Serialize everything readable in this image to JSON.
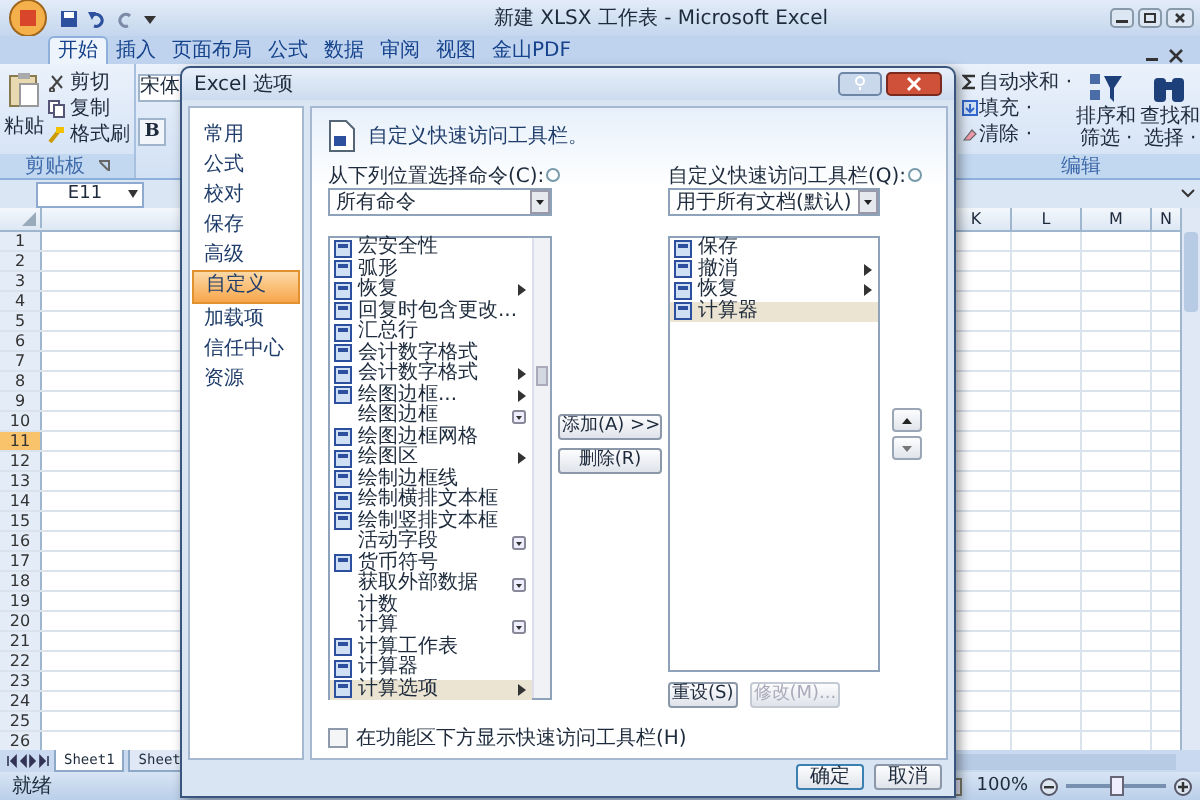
{
  "window": {
    "title": "新建 XLSX 工作表 - Microsoft Excel"
  },
  "ribbon_tabs": [
    {
      "label": "开始",
      "selected": true
    },
    {
      "label": "插入",
      "selected": false
    },
    {
      "label": "页面布局",
      "selected": false
    },
    {
      "label": "公式",
      "selected": false
    },
    {
      "label": "数据",
      "selected": false
    },
    {
      "label": "审阅",
      "selected": false
    },
    {
      "label": "视图",
      "selected": false
    },
    {
      "label": "金山PDF",
      "selected": false
    }
  ],
  "clipboard_group": {
    "paste": "粘贴",
    "commands": [
      "剪切",
      "复制",
      "格式刷"
    ],
    "label": "剪贴板"
  },
  "font_group": {
    "font": "宋体",
    "bold_button": "B"
  },
  "editing_group": {
    "commands": [
      "自动求和 ·",
      "填充 ·",
      "清除 ·"
    ],
    "large_commands": [
      {
        "lines": [
          "排序和",
          "筛选 ·"
        ]
      },
      {
        "lines": [
          "查找和",
          "选择 ·"
        ]
      }
    ],
    "label": "编辑"
  },
  "name_box": "E11",
  "sheet": {
    "columns": [
      "K",
      "L",
      "M",
      "N"
    ],
    "rows": [
      {
        "label": "1",
        "selected": false
      },
      {
        "label": "2",
        "selected": false
      },
      {
        "label": "3",
        "selected": false
      },
      {
        "label": "4",
        "selected": false
      },
      {
        "label": "5",
        "selected": false
      },
      {
        "label": "6",
        "selected": false
      },
      {
        "label": "7",
        "selected": false
      },
      {
        "label": "8",
        "selected": false
      },
      {
        "label": "9",
        "selected": false
      },
      {
        "label": "10",
        "selected": false
      },
      {
        "label": "11",
        "selected": true
      },
      {
        "label": "12",
        "selected": false
      },
      {
        "label": "13",
        "selected": false
      },
      {
        "label": "14",
        "selected": false
      },
      {
        "label": "15",
        "selected": false
      },
      {
        "label": "16",
        "selected": false
      },
      {
        "label": "17",
        "selected": false
      },
      {
        "label": "18",
        "selected": false
      },
      {
        "label": "19",
        "selected": false
      },
      {
        "label": "20",
        "selected": false
      },
      {
        "label": "21",
        "selected": false
      },
      {
        "label": "22",
        "selected": false
      },
      {
        "label": "23",
        "selected": false
      },
      {
        "label": "24",
        "selected": false
      },
      {
        "label": "25",
        "selected": false
      },
      {
        "label": "26",
        "selected": false
      }
    ]
  },
  "sheet_tabs": [
    {
      "label": "Sheet1",
      "selected": true
    },
    {
      "label": "Sheet",
      "selected": false
    }
  ],
  "status_bar": {
    "status": "就绪",
    "zoom": "100%",
    "zoom_slider": {
      "level": 0.5
    }
  },
  "dialog": {
    "title": "Excel 选项",
    "nav": [
      {
        "label": "常用",
        "selected": false
      },
      {
        "label": "公式",
        "selected": false
      },
      {
        "label": "校对",
        "selected": false
      },
      {
        "label": "保存",
        "selected": false
      },
      {
        "label": "高级",
        "selected": false
      },
      {
        "label": "自定义",
        "selected": true
      },
      {
        "label": "加载项",
        "selected": false
      },
      {
        "label": "信任中心",
        "selected": false
      },
      {
        "label": "资源",
        "selected": false
      }
    ],
    "header": "自定义快速访问工具栏。",
    "from_label": "从下列位置选择命令(C):",
    "from_value": "所有命令",
    "to_label": "自定义快速访问工具栏(Q):",
    "to_value": "用于所有文档(默认)",
    "commands": [
      {
        "label": "宏安全性",
        "icon": true,
        "kind": "plain",
        "selected": false
      },
      {
        "label": "弧形",
        "icon": true,
        "kind": "plain",
        "selected": false
      },
      {
        "label": "恢复",
        "icon": true,
        "kind": "submenu",
        "selected": false
      },
      {
        "label": "回复时包含更改...",
        "icon": true,
        "kind": "plain",
        "selected": false
      },
      {
        "label": "汇总行",
        "icon": true,
        "kind": "plain",
        "selected": false
      },
      {
        "label": "会计数字格式",
        "icon": true,
        "kind": "plain",
        "selected": false
      },
      {
        "label": "会计数字格式",
        "icon": true,
        "kind": "submenu",
        "selected": false
      },
      {
        "label": "绘图边框...",
        "icon": true,
        "kind": "submenu",
        "selected": false
      },
      {
        "label": "绘图边框",
        "icon": false,
        "kind": "dropdown",
        "selected": false
      },
      {
        "label": "绘图边框网格",
        "icon": true,
        "kind": "plain",
        "selected": false
      },
      {
        "label": "绘图区",
        "icon": true,
        "kind": "submenu",
        "selected": false
      },
      {
        "label": "绘制边框线",
        "icon": true,
        "kind": "plain",
        "selected": false
      },
      {
        "label": "绘制横排文本框",
        "icon": true,
        "kind": "plain",
        "selected": false
      },
      {
        "label": "绘制竖排文本框",
        "icon": true,
        "kind": "plain",
        "selected": false
      },
      {
        "label": "活动字段",
        "icon": false,
        "kind": "dropdown",
        "selected": false
      },
      {
        "label": "货币符号",
        "icon": true,
        "kind": "plain",
        "selected": false
      },
      {
        "label": "获取外部数据",
        "icon": false,
        "kind": "dropdown",
        "selected": false
      },
      {
        "label": "计数",
        "icon": false,
        "kind": "plain",
        "selected": false
      },
      {
        "label": "计算",
        "icon": false,
        "kind": "dropdown",
        "selected": false
      },
      {
        "label": "计算工作表",
        "icon": true,
        "kind": "plain",
        "selected": false
      },
      {
        "label": "计算器",
        "icon": true,
        "kind": "plain",
        "selected": false
      },
      {
        "label": "计算选项",
        "icon": true,
        "kind": "submenu",
        "selected": true
      }
    ],
    "add_button": "添加(A) >>",
    "remove_button": "删除(R)",
    "toolbar_commands": [
      {
        "label": "保存",
        "kind": "plain",
        "selected": false
      },
      {
        "label": "撤消",
        "kind": "submenu",
        "selected": false
      },
      {
        "label": "恢复",
        "kind": "submenu",
        "selected": false
      },
      {
        "label": "计算器",
        "kind": "plain",
        "selected": true
      }
    ],
    "reset_button": "重设(S)",
    "modify_button": {
      "label": "修改(M)...",
      "disabled": true
    },
    "checkbox": {
      "label": "在功能区下方显示快速访问工具栏(H)",
      "checked": false
    },
    "buttons": [
      "确定",
      "取消"
    ]
  }
}
